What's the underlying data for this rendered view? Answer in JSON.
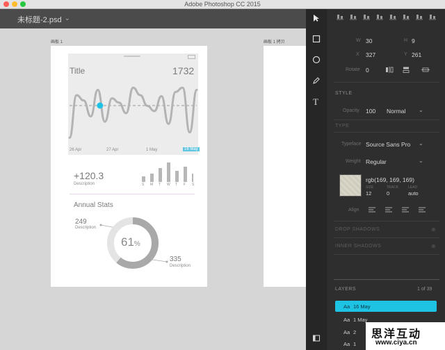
{
  "window": {
    "app_title": "Adobe Photoshop CC 2015"
  },
  "document": {
    "tab_title": "未标题-2.psd"
  },
  "artboards": {
    "label1": "画板 1",
    "label2": "画板 1 拷贝"
  },
  "design": {
    "title": "Title",
    "value": "1732",
    "date_labels": [
      "26 Apr",
      "27 Apr",
      "1 May",
      "16 May"
    ],
    "stat_value": "+120.3",
    "stat_desc": "Description",
    "weekdays": [
      "S",
      "M",
      "T",
      "W",
      "T",
      "F",
      "S"
    ],
    "annual_title": "Annual Stats",
    "left_num": "249",
    "left_desc": "Description",
    "donut_value": "61",
    "donut_unit": "%",
    "right_num": "335",
    "right_desc": "Description"
  },
  "chart_data": {
    "type": "bar",
    "categories": [
      "S",
      "M",
      "T",
      "W",
      "T",
      "F",
      "S"
    ],
    "values": [
      4,
      6,
      10,
      14,
      8,
      11,
      6
    ],
    "title": "",
    "xlabel": "",
    "ylabel": "",
    "ylim": [
      0,
      14
    ]
  },
  "line_chart": {
    "type": "line",
    "values": [
      5,
      45,
      40,
      25,
      50,
      20,
      42,
      38,
      28,
      52,
      45,
      35,
      30,
      44,
      18,
      48,
      52,
      10,
      50
    ],
    "highlight_index": 5
  },
  "donut": {
    "fraction": 0.61
  },
  "panel": {
    "w_label": "W",
    "w_value": "30",
    "h_label": "H",
    "h_value": "9",
    "x_label": "X",
    "x_value": "327",
    "y_label": "Y",
    "y_value": "261",
    "rotate_label": "Rotate",
    "rotate_value": "0",
    "style_heading": "STYLE",
    "opacity_label": "Opacity",
    "opacity_value": "100",
    "blend_value": "Normal",
    "type_heading": "TYPE",
    "typeface_label": "Typeface",
    "typeface_value": "Source Sans Pro",
    "weight_label": "Weight",
    "weight_value": "Regular",
    "color_value": "rgb(169, 169, 169)",
    "size_label": "SIZE",
    "size_value": "12",
    "tracking_label": "TRACK",
    "tracking_value": "0",
    "leading_label": "LEAD",
    "leading_value": "auto",
    "align_label": "Align",
    "drop_shadows": "DROP SHADOWS",
    "inner_shadows": "INNER SHADOWS",
    "layers_heading": "LAYERS",
    "layers_count": "1 of 39",
    "layers": [
      {
        "icon": "Aa",
        "name": "16 May"
      },
      {
        "icon": "Aa",
        "name": "1 May"
      },
      {
        "icon": "Aa",
        "name": "2"
      },
      {
        "icon": "Aa",
        "name": "1"
      }
    ]
  },
  "watermark": {
    "title": "思洋互动",
    "url": "www.ciya.cn"
  },
  "colors": {
    "accent": "#1ec3e4",
    "panel": "#2e2e2e",
    "canvas": "#d6d6d6"
  }
}
